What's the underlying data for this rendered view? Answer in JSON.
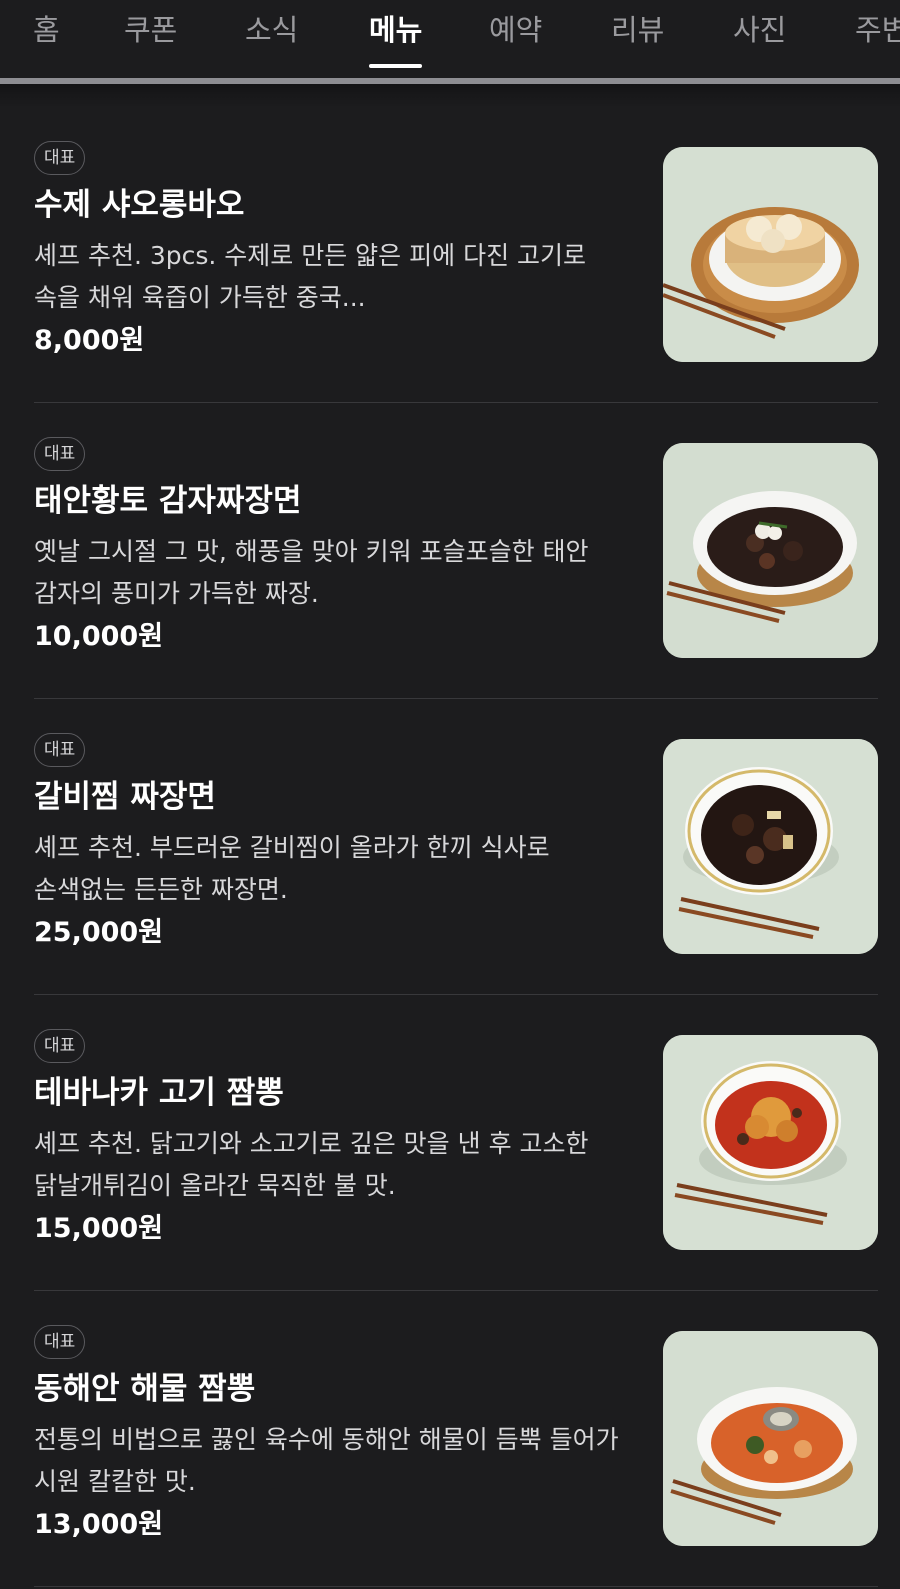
{
  "tabs": [
    {
      "label": "홈",
      "active": false
    },
    {
      "label": "쿠폰",
      "active": false
    },
    {
      "label": "소식",
      "active": false
    },
    {
      "label": "메뉴",
      "active": true
    },
    {
      "label": "예약",
      "active": false
    },
    {
      "label": "리뷰",
      "active": false
    },
    {
      "label": "사진",
      "active": false
    },
    {
      "label": "주변",
      "active": false
    }
  ],
  "menu": {
    "items": [
      {
        "badge": "대표",
        "name": "수제 샤오롱바오",
        "description": "셰프 추천. 3pcs. 수제로 만든 얇은 피에 다진 고기로 속을 채워 육즙이 가득한 중국...",
        "price": "8,000원",
        "image_icon": "xiaolongbao-dumplings-photo"
      },
      {
        "badge": "대표",
        "name": "태안황토 감자짜장면",
        "description": "옛날 그시절 그 맛, 해풍을 맞아 키워 포슬포슬한 태안 감자의 풍미가 가득한 짜장.",
        "price": "10,000원",
        "image_icon": "potato-jajangmyeon-photo"
      },
      {
        "badge": "대표",
        "name": "갈비찜 짜장면",
        "description": "셰프 추천. 부드러운 갈비찜이 올라가 한끼 식사로 손색없는 든든한 짜장면.",
        "price": "25,000원",
        "image_icon": "galbijjim-jajangmyeon-photo"
      },
      {
        "badge": "대표",
        "name": "테바나카 고기 짬뽕",
        "description": "셰프 추천. 닭고기와 소고기로 깊은 맛을 낸 후 고소한 닭날개튀김이 올라간 묵직한 불 맛.",
        "price": "15,000원",
        "image_icon": "tebanaka-jjamppong-photo"
      },
      {
        "badge": "대표",
        "name": "동해안 해물 짬뽕",
        "description": "전통의 비법으로 끓인 육수에 동해안 해물이 듬뿍 들어가 시원 칼칼한 맛.",
        "price": "13,000원",
        "image_icon": "seafood-jjamppong-photo"
      }
    ]
  },
  "colors": {
    "background": "#1c1c1e",
    "text_primary": "#ffffff",
    "text_secondary": "#d8d8da",
    "tab_inactive": "#9a9a9e",
    "photo_background": "#d8e2d6"
  }
}
